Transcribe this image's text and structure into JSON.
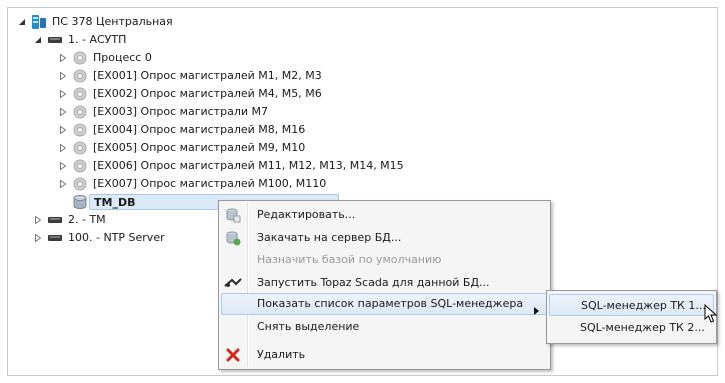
{
  "tree": {
    "root": {
      "label": "ПС 378 Центральная",
      "icon": "server-icon"
    },
    "items": [
      {
        "label": "1. - АСУТП",
        "icon": "network-card-icon",
        "expanded": true
      },
      {
        "label": "Процесс 0",
        "icon": "gear-icon"
      },
      {
        "label": "[EX001] Опрос магистралей M1, M2, M3",
        "icon": "gear-icon"
      },
      {
        "label": "[EX002] Опрос магистралей M4, M5, M6",
        "icon": "gear-icon"
      },
      {
        "label": "[EX003] Опрос магистрали M7",
        "icon": "gear-icon"
      },
      {
        "label": "[EX004] Опрос магистралей M8, M16",
        "icon": "gear-icon"
      },
      {
        "label": "[EX005] Опрос магистралей M9, M10",
        "icon": "gear-icon"
      },
      {
        "label": "[EX006] Опрос магистралей M11, M12, M13, M14, M15",
        "icon": "gear-icon"
      },
      {
        "label": "[EX007] Опрос магистралей M100, M110",
        "icon": "gear-icon"
      },
      {
        "label": "TM_DB",
        "icon": "database-icon",
        "selected": true
      },
      {
        "label": "2. - TM",
        "icon": "network-card-icon"
      },
      {
        "label": "100. - NTP Server",
        "icon": "network-card-icon"
      }
    ]
  },
  "context_menu": {
    "items": [
      {
        "label": "Редактировать...",
        "icon": "edit-db-icon"
      },
      {
        "label": "Закачать на сервер БД...",
        "icon": "upload-db-icon"
      },
      {
        "label": "Назначить базой по умолчанию",
        "disabled": true
      },
      {
        "label": "Запустить Topaz Scada для данной БД...",
        "icon": "launch-icon"
      },
      {
        "label": "Показать список параметров SQL-менеджера",
        "has_submenu": true,
        "highlighted": true
      },
      {
        "label": "Снять выделение"
      },
      {
        "label": "Удалить",
        "icon": "delete-icon"
      }
    ]
  },
  "submenu": {
    "items": [
      {
        "label": "SQL-менеджер ТК 1...",
        "highlighted": true
      },
      {
        "label": "SQL-менеджер ТК 2..."
      }
    ]
  },
  "colors": {
    "selection_bg": "#dbe9f9",
    "menu_bg": "#f5f5f5",
    "delete_red": "#d9261c"
  }
}
